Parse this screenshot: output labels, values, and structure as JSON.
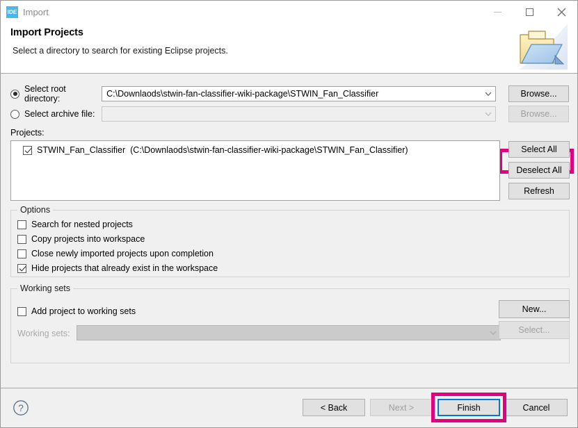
{
  "window": {
    "app_icon_label": "IDE",
    "title": "Import",
    "minimize_tooltip": "Minimize",
    "maximize_tooltip": "Maximize",
    "close_tooltip": "Close"
  },
  "header": {
    "title": "Import Projects",
    "description": "Select a directory to search for existing Eclipse projects.",
    "banner_icon": "import-folder-icon"
  },
  "source": {
    "root_directory": {
      "radio_label": "Select root directory:",
      "selected": true,
      "value": "C:\\Downlaods\\stwin-fan-classifier-wiki-package\\STWIN_Fan_Classifier",
      "browse_label": "Browse...",
      "browse_enabled": true
    },
    "archive_file": {
      "radio_label": "Select archive file:",
      "selected": false,
      "value": "",
      "browse_label": "Browse...",
      "browse_enabled": false
    }
  },
  "projects": {
    "label": "Projects:",
    "items": [
      {
        "name": "STWIN_Fan_Classifier",
        "path": "(C:\\Downlaods\\stwin-fan-classifier-wiki-package\\STWIN_Fan_Classifier)",
        "checked": true
      }
    ],
    "buttons": [
      {
        "label": "Select All",
        "enabled": true
      },
      {
        "label": "Deselect All",
        "enabled": true
      },
      {
        "label": "Refresh",
        "enabled": true
      }
    ]
  },
  "options": {
    "title": "Options",
    "items": [
      {
        "label": "Search for nested projects",
        "checked": false
      },
      {
        "label": "Copy projects into workspace",
        "checked": false
      },
      {
        "label": "Close newly imported projects upon completion",
        "checked": false
      },
      {
        "label": "Hide projects that already exist in the workspace",
        "checked": true
      }
    ]
  },
  "working_sets": {
    "title": "Working sets",
    "add_checkbox_label": "Add project to working sets",
    "add_checked": false,
    "combo_label": "Working sets:",
    "combo_value": "",
    "combo_enabled": false,
    "new_label": "New...",
    "new_enabled": true,
    "select_label": "Select...",
    "select_enabled": false
  },
  "footer": {
    "help_icon": "help-question-icon",
    "back_label": "< Back",
    "back_enabled": true,
    "next_label": "Next >",
    "next_enabled": false,
    "finish_label": "Finish",
    "finish_enabled": true,
    "finish_focused": true,
    "cancel_label": "Cancel",
    "cancel_enabled": true
  },
  "annotations": {
    "highlight_color": "#e3007e",
    "arrow_direction": "left",
    "targets": [
      "browse-button-root",
      "finish-button",
      "root-directory-value"
    ]
  }
}
